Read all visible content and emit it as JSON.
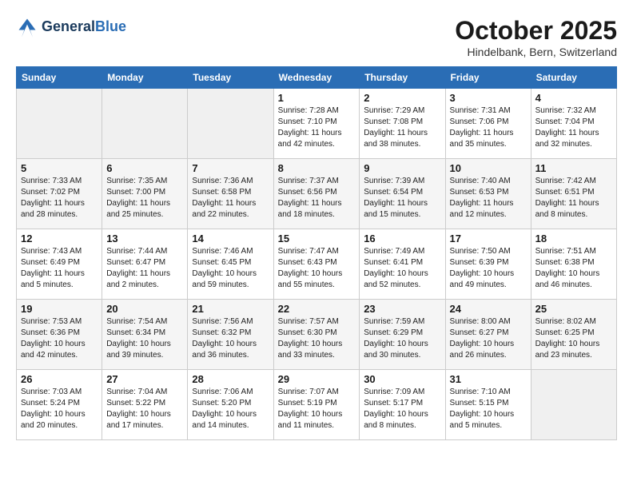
{
  "header": {
    "logo_line1": "General",
    "logo_line2": "Blue",
    "month_year": "October 2025",
    "location": "Hindelbank, Bern, Switzerland"
  },
  "weekdays": [
    "Sunday",
    "Monday",
    "Tuesday",
    "Wednesday",
    "Thursday",
    "Friday",
    "Saturday"
  ],
  "weeks": [
    [
      null,
      null,
      null,
      {
        "day": "1",
        "sunrise": "Sunrise: 7:28 AM",
        "sunset": "Sunset: 7:10 PM",
        "daylight": "Daylight: 11 hours and 42 minutes."
      },
      {
        "day": "2",
        "sunrise": "Sunrise: 7:29 AM",
        "sunset": "Sunset: 7:08 PM",
        "daylight": "Daylight: 11 hours and 38 minutes."
      },
      {
        "day": "3",
        "sunrise": "Sunrise: 7:31 AM",
        "sunset": "Sunset: 7:06 PM",
        "daylight": "Daylight: 11 hours and 35 minutes."
      },
      {
        "day": "4",
        "sunrise": "Sunrise: 7:32 AM",
        "sunset": "Sunset: 7:04 PM",
        "daylight": "Daylight: 11 hours and 32 minutes."
      }
    ],
    [
      {
        "day": "5",
        "sunrise": "Sunrise: 7:33 AM",
        "sunset": "Sunset: 7:02 PM",
        "daylight": "Daylight: 11 hours and 28 minutes."
      },
      {
        "day": "6",
        "sunrise": "Sunrise: 7:35 AM",
        "sunset": "Sunset: 7:00 PM",
        "daylight": "Daylight: 11 hours and 25 minutes."
      },
      {
        "day": "7",
        "sunrise": "Sunrise: 7:36 AM",
        "sunset": "Sunset: 6:58 PM",
        "daylight": "Daylight: 11 hours and 22 minutes."
      },
      {
        "day": "8",
        "sunrise": "Sunrise: 7:37 AM",
        "sunset": "Sunset: 6:56 PM",
        "daylight": "Daylight: 11 hours and 18 minutes."
      },
      {
        "day": "9",
        "sunrise": "Sunrise: 7:39 AM",
        "sunset": "Sunset: 6:54 PM",
        "daylight": "Daylight: 11 hours and 15 minutes."
      },
      {
        "day": "10",
        "sunrise": "Sunrise: 7:40 AM",
        "sunset": "Sunset: 6:53 PM",
        "daylight": "Daylight: 11 hours and 12 minutes."
      },
      {
        "day": "11",
        "sunrise": "Sunrise: 7:42 AM",
        "sunset": "Sunset: 6:51 PM",
        "daylight": "Daylight: 11 hours and 8 minutes."
      }
    ],
    [
      {
        "day": "12",
        "sunrise": "Sunrise: 7:43 AM",
        "sunset": "Sunset: 6:49 PM",
        "daylight": "Daylight: 11 hours and 5 minutes."
      },
      {
        "day": "13",
        "sunrise": "Sunrise: 7:44 AM",
        "sunset": "Sunset: 6:47 PM",
        "daylight": "Daylight: 11 hours and 2 minutes."
      },
      {
        "day": "14",
        "sunrise": "Sunrise: 7:46 AM",
        "sunset": "Sunset: 6:45 PM",
        "daylight": "Daylight: 10 hours and 59 minutes."
      },
      {
        "day": "15",
        "sunrise": "Sunrise: 7:47 AM",
        "sunset": "Sunset: 6:43 PM",
        "daylight": "Daylight: 10 hours and 55 minutes."
      },
      {
        "day": "16",
        "sunrise": "Sunrise: 7:49 AM",
        "sunset": "Sunset: 6:41 PM",
        "daylight": "Daylight: 10 hours and 52 minutes."
      },
      {
        "day": "17",
        "sunrise": "Sunrise: 7:50 AM",
        "sunset": "Sunset: 6:39 PM",
        "daylight": "Daylight: 10 hours and 49 minutes."
      },
      {
        "day": "18",
        "sunrise": "Sunrise: 7:51 AM",
        "sunset": "Sunset: 6:38 PM",
        "daylight": "Daylight: 10 hours and 46 minutes."
      }
    ],
    [
      {
        "day": "19",
        "sunrise": "Sunrise: 7:53 AM",
        "sunset": "Sunset: 6:36 PM",
        "daylight": "Daylight: 10 hours and 42 minutes."
      },
      {
        "day": "20",
        "sunrise": "Sunrise: 7:54 AM",
        "sunset": "Sunset: 6:34 PM",
        "daylight": "Daylight: 10 hours and 39 minutes."
      },
      {
        "day": "21",
        "sunrise": "Sunrise: 7:56 AM",
        "sunset": "Sunset: 6:32 PM",
        "daylight": "Daylight: 10 hours and 36 minutes."
      },
      {
        "day": "22",
        "sunrise": "Sunrise: 7:57 AM",
        "sunset": "Sunset: 6:30 PM",
        "daylight": "Daylight: 10 hours and 33 minutes."
      },
      {
        "day": "23",
        "sunrise": "Sunrise: 7:59 AM",
        "sunset": "Sunset: 6:29 PM",
        "daylight": "Daylight: 10 hours and 30 minutes."
      },
      {
        "day": "24",
        "sunrise": "Sunrise: 8:00 AM",
        "sunset": "Sunset: 6:27 PM",
        "daylight": "Daylight: 10 hours and 26 minutes."
      },
      {
        "day": "25",
        "sunrise": "Sunrise: 8:02 AM",
        "sunset": "Sunset: 6:25 PM",
        "daylight": "Daylight: 10 hours and 23 minutes."
      }
    ],
    [
      {
        "day": "26",
        "sunrise": "Sunrise: 7:03 AM",
        "sunset": "Sunset: 5:24 PM",
        "daylight": "Daylight: 10 hours and 20 minutes."
      },
      {
        "day": "27",
        "sunrise": "Sunrise: 7:04 AM",
        "sunset": "Sunset: 5:22 PM",
        "daylight": "Daylight: 10 hours and 17 minutes."
      },
      {
        "day": "28",
        "sunrise": "Sunrise: 7:06 AM",
        "sunset": "Sunset: 5:20 PM",
        "daylight": "Daylight: 10 hours and 14 minutes."
      },
      {
        "day": "29",
        "sunrise": "Sunrise: 7:07 AM",
        "sunset": "Sunset: 5:19 PM",
        "daylight": "Daylight: 10 hours and 11 minutes."
      },
      {
        "day": "30",
        "sunrise": "Sunrise: 7:09 AM",
        "sunset": "Sunset: 5:17 PM",
        "daylight": "Daylight: 10 hours and 8 minutes."
      },
      {
        "day": "31",
        "sunrise": "Sunrise: 7:10 AM",
        "sunset": "Sunset: 5:15 PM",
        "daylight": "Daylight: 10 hours and 5 minutes."
      },
      null
    ]
  ]
}
